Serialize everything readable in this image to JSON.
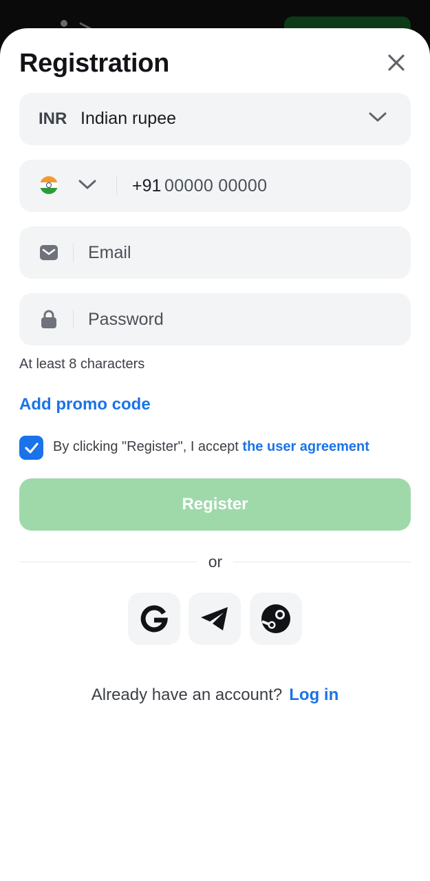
{
  "title": "Registration",
  "currency": {
    "code": "INR",
    "name": "Indian rupee"
  },
  "phone": {
    "prefix": "+91",
    "placeholder": "00000 00000"
  },
  "email": {
    "placeholder": "Email"
  },
  "password": {
    "placeholder": "Password",
    "hint": "At least 8 characters"
  },
  "promo_label": "Add promo code",
  "agreement": {
    "checked": true,
    "text": "By clicking \"Register\", I accept ",
    "link": "the user agreement"
  },
  "register_label": "Register",
  "divider_text": "or",
  "social": [
    "google-icon",
    "telegram-icon",
    "steam-icon"
  ],
  "footer": {
    "text": "Already have an account?",
    "link": "Log in"
  },
  "colors": {
    "accent": "#1a73e8",
    "register_disabled": "#9fd9aa",
    "field_bg": "#f3f4f5"
  }
}
